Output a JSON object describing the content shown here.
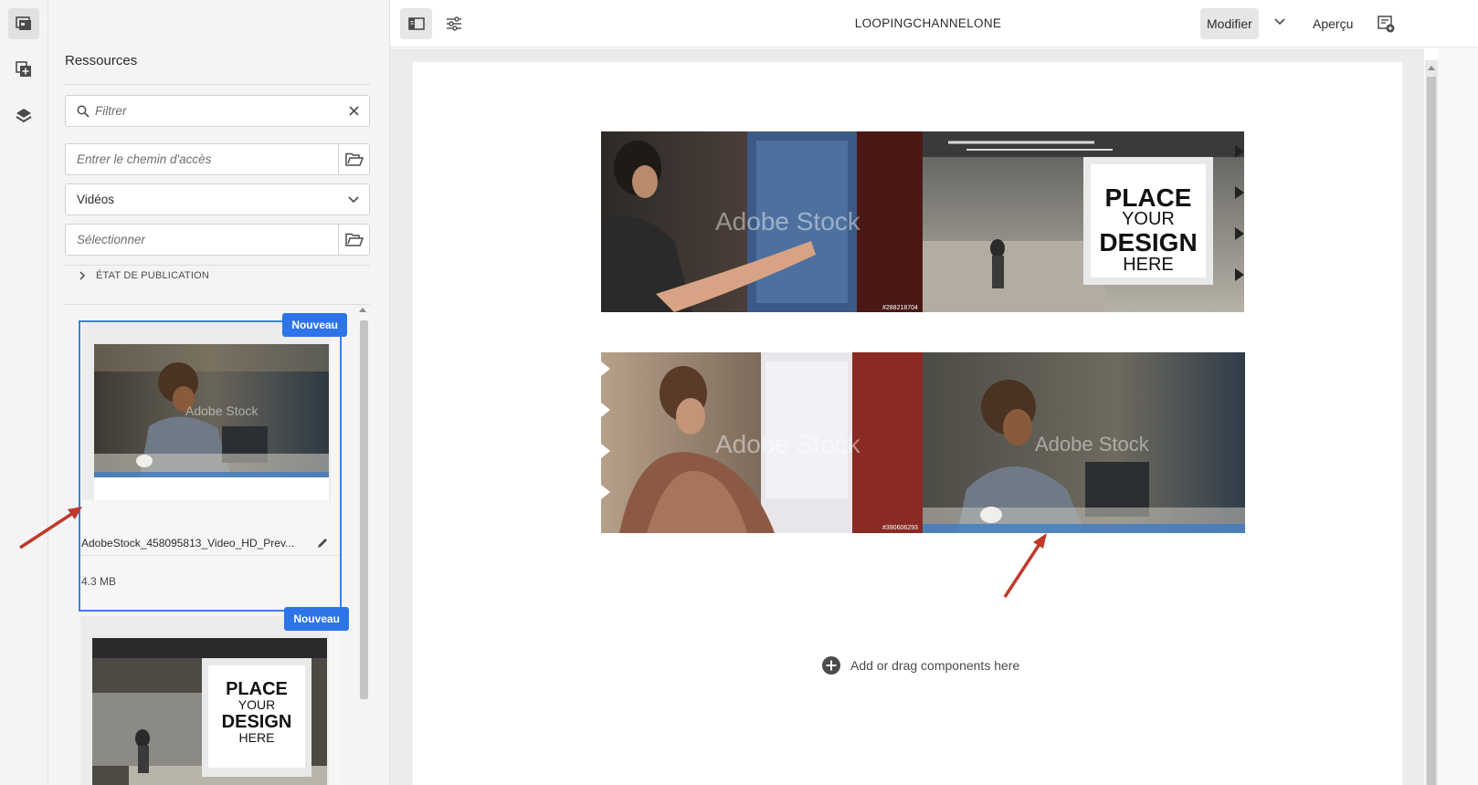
{
  "rail": {
    "items": [
      {
        "name": "assets-rail-icon",
        "active": true
      },
      {
        "name": "components-rail-icon",
        "active": false
      },
      {
        "name": "layers-rail-icon",
        "active": false
      }
    ]
  },
  "panel": {
    "title": "Ressources",
    "filter_placeholder": "Filtrer",
    "path_placeholder": "Entrer le chemin d'accès",
    "type_value": "Vidéos",
    "select_placeholder": "Sélectionner",
    "publication_label": "ÉTAT DE PUBLICATION",
    "cards": [
      {
        "badge": "Nouveau",
        "filename": "AdobeStock_458095813_Video_HD_Prev...",
        "size": "4.3 MB",
        "selected": true
      },
      {
        "badge": "Nouveau",
        "filename": "",
        "size": "",
        "selected": false
      }
    ]
  },
  "topbar": {
    "title": "LOOPINGCHANNELONE",
    "edit_label": "Modifier",
    "preview_label": "Aperçu"
  },
  "canvas": {
    "placeholder_text": "Add or drag components here",
    "videos": [
      {
        "name": "video-component-1",
        "overlay_lines": [
          "PLACE",
          "YOUR",
          "DESIGN",
          "HERE"
        ],
        "watermark": "Adobe Stock",
        "stock_id": "#288218704"
      },
      {
        "name": "video-component-2",
        "watermark": "Adobe Stock",
        "stock_id": "#390606293"
      }
    ]
  },
  "colors": {
    "accent": "#2d74e8",
    "selection": "#3a7ff2",
    "annotation_arrow": "#c0392b",
    "panel_bg": "#f4f4f4"
  }
}
